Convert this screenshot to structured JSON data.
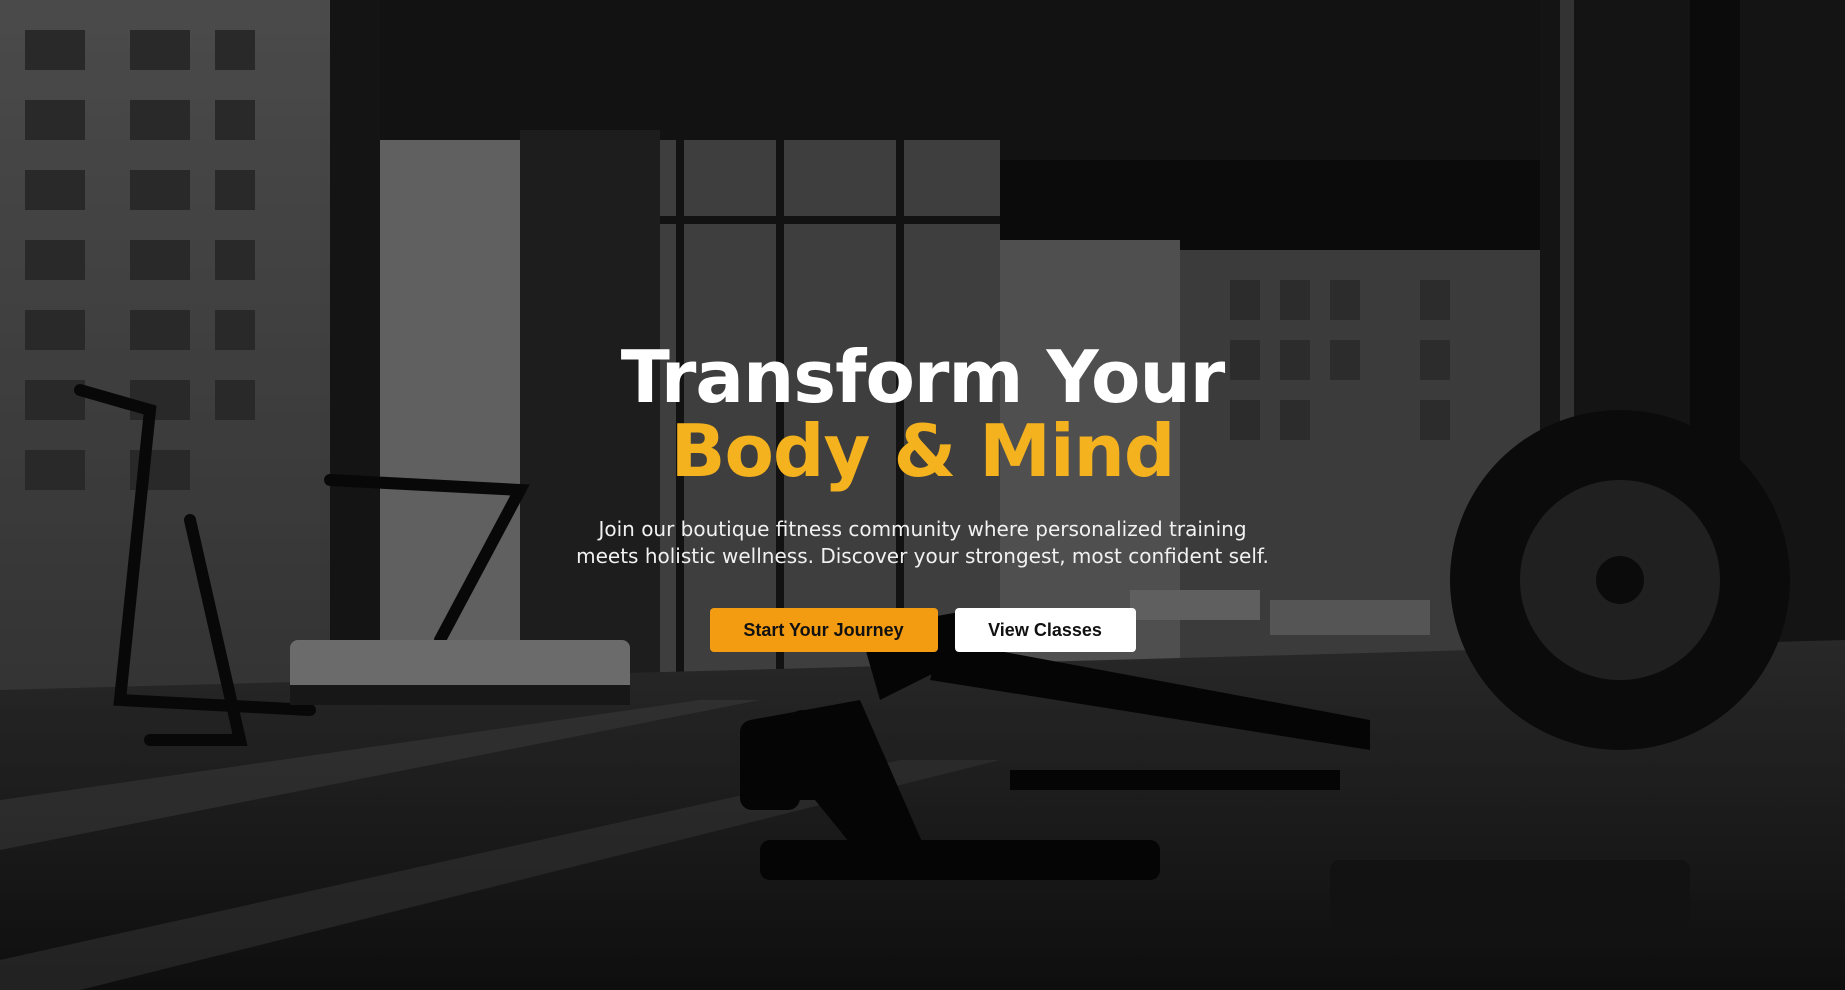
{
  "hero": {
    "headline_line1": "Transform Your",
    "headline_line2": "Body & Mind",
    "subtitle": "Join our boutique fitness community where personalized training meets holistic wellness. Discover your strongest, most confident self.",
    "primary_cta": "Start Your Journey",
    "secondary_cta": "View Classes",
    "background_icon": "gym-photo",
    "colors": {
      "accent": "#f5b21f",
      "primary_button": "#f39c12",
      "secondary_button": "#ffffff"
    }
  }
}
